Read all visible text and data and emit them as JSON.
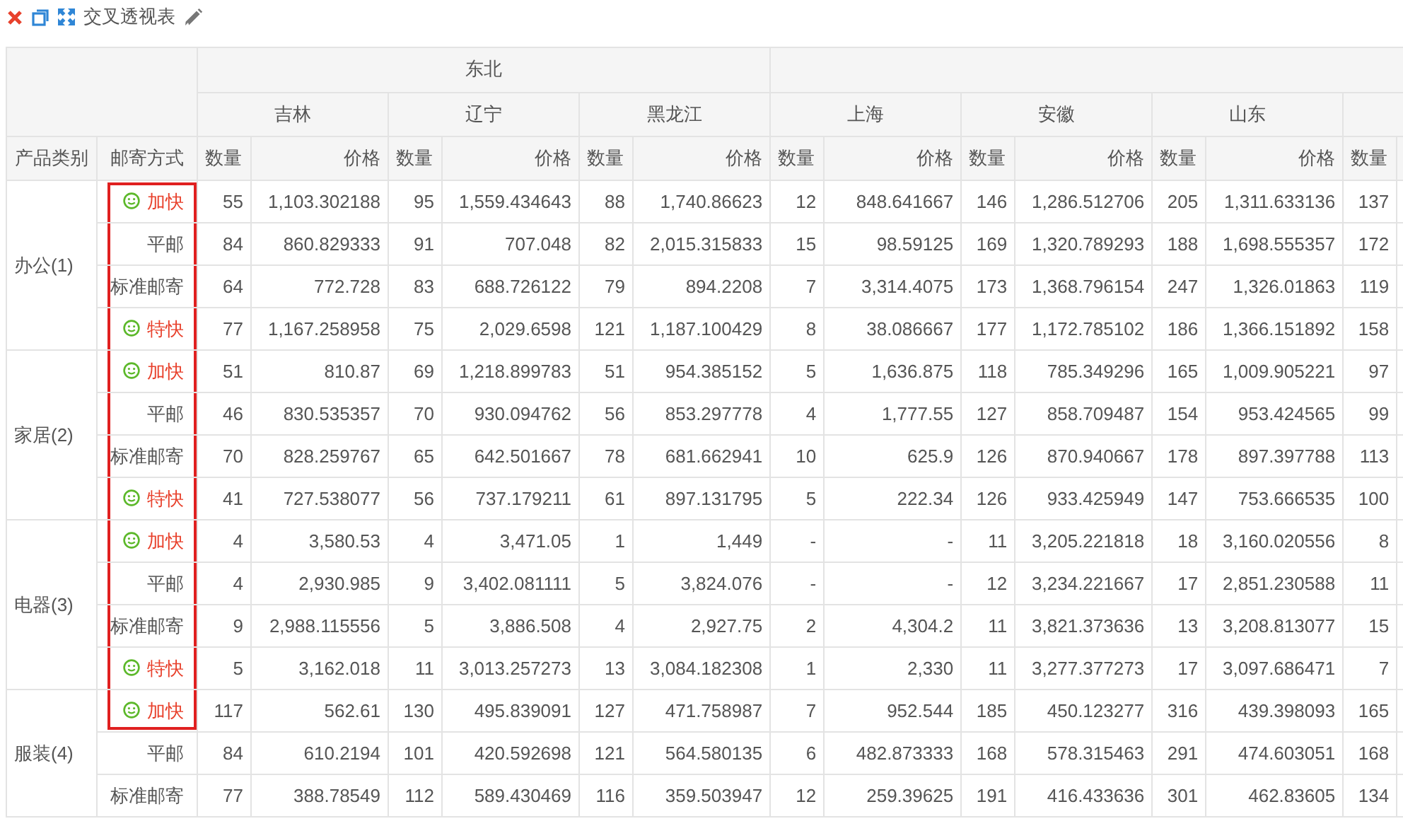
{
  "toolbar": {
    "title": "交叉透视表"
  },
  "table": {
    "corner_headers": [
      "产品类别",
      "邮寄方式"
    ],
    "column_groups": [
      {
        "region": "东北",
        "provinces": [
          {
            "name": "吉林",
            "measures": [
              "数量",
              "价格"
            ]
          },
          {
            "name": "辽宁",
            "measures": [
              "数量",
              "价格"
            ]
          },
          {
            "name": "黑龙江",
            "measures": [
              "数量",
              "价格"
            ]
          }
        ]
      },
      {
        "provinces": [
          {
            "name": "上海",
            "measures": [
              "数量",
              "价格"
            ]
          },
          {
            "name": "安徽",
            "measures": [
              "数量",
              "价格"
            ]
          },
          {
            "name": "山东",
            "measures": [
              "数量",
              "价格"
            ]
          },
          {
            "measures": [
              "数量"
            ]
          }
        ]
      }
    ],
    "row_groups": [
      {
        "category": "办公(1)",
        "rows": [
          {
            "method": "加快",
            "flagged": true,
            "outlined": true,
            "values": [
              "55",
              "1,103.302188",
              "95",
              "1,559.434643",
              "88",
              "1,740.86623",
              "12",
              "848.641667",
              "146",
              "1,286.512706",
              "205",
              "1,311.633136",
              "137"
            ]
          },
          {
            "method": "平邮",
            "flagged": false,
            "outlined": true,
            "values": [
              "84",
              "860.829333",
              "91",
              "707.048",
              "82",
              "2,015.315833",
              "15",
              "98.59125",
              "169",
              "1,320.789293",
              "188",
              "1,698.555357",
              "172"
            ]
          },
          {
            "method": "标准邮寄",
            "flagged": false,
            "outlined": true,
            "values": [
              "64",
              "772.728",
              "83",
              "688.726122",
              "79",
              "894.2208",
              "7",
              "3,314.4075",
              "173",
              "1,368.796154",
              "247",
              "1,326.01863",
              "119"
            ]
          },
          {
            "method": "特快",
            "flagged": true,
            "outlined": true,
            "values": [
              "77",
              "1,167.258958",
              "75",
              "2,029.6598",
              "121",
              "1,187.100429",
              "8",
              "38.086667",
              "177",
              "1,172.785102",
              "186",
              "1,366.151892",
              "158"
            ]
          }
        ]
      },
      {
        "category": "家居(2)",
        "rows": [
          {
            "method": "加快",
            "flagged": true,
            "outlined": true,
            "values": [
              "51",
              "810.87",
              "69",
              "1,218.899783",
              "51",
              "954.385152",
              "5",
              "1,636.875",
              "118",
              "785.349296",
              "165",
              "1,009.905221",
              "97"
            ]
          },
          {
            "method": "平邮",
            "flagged": false,
            "outlined": true,
            "values": [
              "46",
              "830.535357",
              "70",
              "930.094762",
              "56",
              "853.297778",
              "4",
              "1,777.55",
              "127",
              "858.709487",
              "154",
              "953.424565",
              "99"
            ]
          },
          {
            "method": "标准邮寄",
            "flagged": false,
            "outlined": true,
            "values": [
              "70",
              "828.259767",
              "65",
              "642.501667",
              "78",
              "681.662941",
              "10",
              "625.9",
              "126",
              "870.940667",
              "178",
              "897.397788",
              "113"
            ]
          },
          {
            "method": "特快",
            "flagged": true,
            "outlined": true,
            "values": [
              "41",
              "727.538077",
              "56",
              "737.179211",
              "61",
              "897.131795",
              "5",
              "222.34",
              "126",
              "933.425949",
              "147",
              "753.666535",
              "100"
            ]
          }
        ]
      },
      {
        "category": "电器(3)",
        "rows": [
          {
            "method": "加快",
            "flagged": true,
            "outlined": true,
            "values": [
              "4",
              "3,580.53",
              "4",
              "3,471.05",
              "1",
              "1,449",
              "-",
              "-",
              "11",
              "3,205.221818",
              "18",
              "3,160.020556",
              "8"
            ]
          },
          {
            "method": "平邮",
            "flagged": false,
            "outlined": true,
            "values": [
              "4",
              "2,930.985",
              "9",
              "3,402.081111",
              "5",
              "3,824.076",
              "-",
              "-",
              "12",
              "3,234.221667",
              "17",
              "2,851.230588",
              "11"
            ]
          },
          {
            "method": "标准邮寄",
            "flagged": false,
            "outlined": true,
            "values": [
              "9",
              "2,988.115556",
              "5",
              "3,886.508",
              "4",
              "2,927.75",
              "2",
              "4,304.2",
              "11",
              "3,821.373636",
              "13",
              "3,208.813077",
              "15"
            ]
          },
          {
            "method": "特快",
            "flagged": true,
            "outlined": true,
            "values": [
              "5",
              "3,162.018",
              "11",
              "3,013.257273",
              "13",
              "3,084.182308",
              "1",
              "2,330",
              "11",
              "3,277.377273",
              "17",
              "3,097.686471",
              "7"
            ]
          }
        ]
      },
      {
        "category": "服装(4)",
        "rows": [
          {
            "method": "加快",
            "flagged": true,
            "outlined": true,
            "values": [
              "117",
              "562.61",
              "130",
              "495.839091",
              "127",
              "471.758987",
              "7",
              "952.544",
              "185",
              "450.123277",
              "316",
              "439.398093",
              "165"
            ]
          },
          {
            "method": "平邮",
            "flagged": false,
            "outlined": false,
            "values": [
              "84",
              "610.2194",
              "101",
              "420.592698",
              "121",
              "564.580135",
              "6",
              "482.873333",
              "168",
              "578.315463",
              "291",
              "474.603051",
              "168"
            ]
          },
          {
            "method": "标准邮寄",
            "flagged": false,
            "outlined": false,
            "values": [
              "77",
              "388.78549",
              "112",
              "589.430469",
              "116",
              "359.503947",
              "12",
              "259.39625",
              "191",
              "416.433636",
              "301",
              "462.83605",
              "134"
            ]
          }
        ]
      }
    ]
  }
}
